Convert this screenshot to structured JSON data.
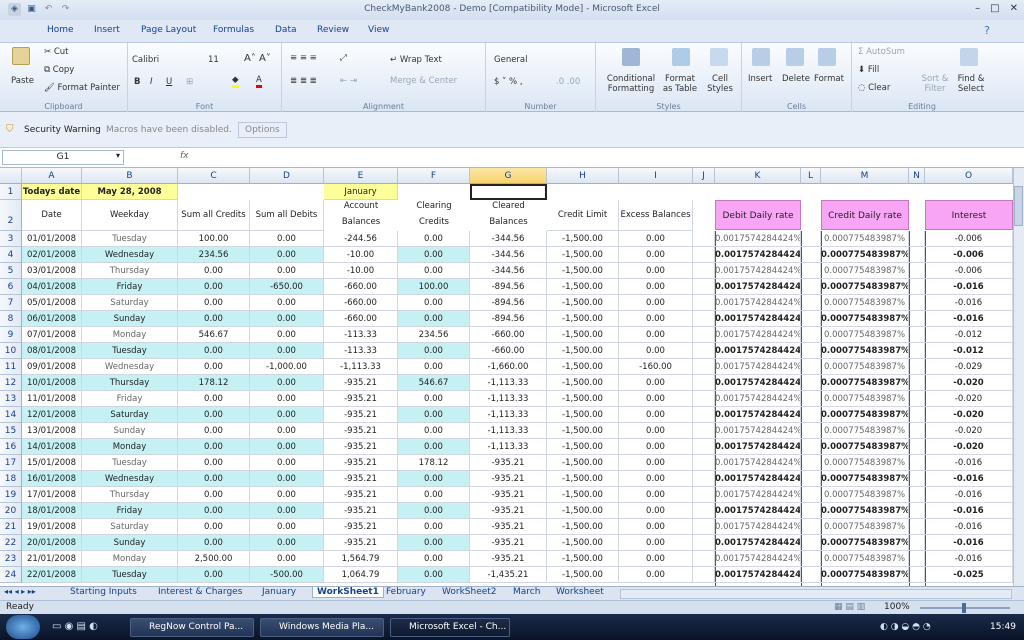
{
  "title": "CheckMyBank2008 - Demo  [Compatibility Mode] - Microsoft Excel",
  "ribbon_tabs": [
    "Home",
    "Insert",
    "Page Layout",
    "Formulas",
    "Data",
    "Review",
    "View"
  ],
  "clipboard": {
    "paste": "Paste",
    "cut": "Cut",
    "copy": "Copy",
    "format_painter": "Format Painter",
    "label": "Clipboard"
  },
  "font": {
    "name": "Calibri",
    "size": "11",
    "label": "Font"
  },
  "alignment": {
    "wrap": "Wrap Text",
    "merge": "Merge & Center",
    "label": "Alignment"
  },
  "number": {
    "format": "General",
    "label": "Number"
  },
  "styles": {
    "conditional": "Conditional Formatting",
    "format_table": "Format as Table",
    "cell_styles": "Cell Styles",
    "label": "Styles"
  },
  "cells": {
    "insert": "Insert",
    "delete": "Delete",
    "format": "Format",
    "label": "Cells"
  },
  "editing": {
    "autosum": "AutoSum",
    "fill": "Fill",
    "clear": "Clear",
    "sort": "Sort & Filter",
    "find": "Find & Select",
    "label": "Editing"
  },
  "warning": {
    "title": "Security Warning",
    "msg": "Macros have been disabled.",
    "options": "Options"
  },
  "formula_bar": {
    "name_box": "G1",
    "fx": "fx",
    "content": ""
  },
  "columns": [
    "A",
    "B",
    "C",
    "D",
    "E",
    "F",
    "G",
    "H",
    "I",
    "J",
    "K",
    "L",
    "M",
    "N",
    "O"
  ],
  "row1": {
    "a": "Todays date",
    "b": "May 28, 2008",
    "e": "January"
  },
  "headers": {
    "date": "Date",
    "weekday": "Weekday",
    "credits": "Sum all Credits",
    "debits": "Sum all Debits",
    "account1": "Account",
    "account2": "Balances",
    "clearing1": "Clearing",
    "clearing2": "Credits",
    "cleared1": "Cleared",
    "cleared2": "Balances",
    "limit": "Credit Limit",
    "excess": "Excess Balances",
    "debit_rate": "Debit Daily rate",
    "credit_rate": "Credit Daily rate",
    "interest": "Interest"
  },
  "rows": [
    {
      "n": "3",
      "date": "01/01/2008",
      "day": "Tuesday",
      "c": "100.00",
      "d": "0.00",
      "e": "-244.56",
      "f": "0.00",
      "g": "-344.56",
      "h": "-1,500.00",
      "i": "0.00",
      "k": "0.0017574284424%",
      "m": "0.000775483987%",
      "o": "-0.006",
      "hl": false
    },
    {
      "n": "4",
      "date": "02/01/2008",
      "day": "Wednesday",
      "c": "234.56",
      "d": "0.00",
      "e": "-10.00",
      "f": "0.00",
      "g": "-344.56",
      "h": "-1,500.00",
      "i": "0.00",
      "k": "0.0017574284424%",
      "m": "0.000775483987%",
      "o": "-0.006",
      "hl": true
    },
    {
      "n": "5",
      "date": "03/01/2008",
      "day": "Thursday",
      "c": "0.00",
      "d": "0.00",
      "e": "-10.00",
      "f": "0.00",
      "g": "-344.56",
      "h": "-1,500.00",
      "i": "0.00",
      "k": "0.0017574284424%",
      "m": "0.000775483987%",
      "o": "-0.006",
      "hl": false
    },
    {
      "n": "6",
      "date": "04/01/2008",
      "day": "Friday",
      "c": "0.00",
      "d": "-650.00",
      "e": "-660.00",
      "f": "100.00",
      "g": "-894.56",
      "h": "-1,500.00",
      "i": "0.00",
      "k": "0.0017574284424%",
      "m": "0.000775483987%",
      "o": "-0.016",
      "hl": true
    },
    {
      "n": "7",
      "date": "05/01/2008",
      "day": "Saturday",
      "c": "0.00",
      "d": "0.00",
      "e": "-660.00",
      "f": "0.00",
      "g": "-894.56",
      "h": "-1,500.00",
      "i": "0.00",
      "k": "0.0017574284424%",
      "m": "0.000775483987%",
      "o": "-0.016",
      "hl": false
    },
    {
      "n": "8",
      "date": "06/01/2008",
      "day": "Sunday",
      "c": "0.00",
      "d": "0.00",
      "e": "-660.00",
      "f": "0.00",
      "g": "-894.56",
      "h": "-1,500.00",
      "i": "0.00",
      "k": "0.0017574284424%",
      "m": "0.000775483987%",
      "o": "-0.016",
      "hl": true
    },
    {
      "n": "9",
      "date": "07/01/2008",
      "day": "Monday",
      "c": "546.67",
      "d": "0.00",
      "e": "-113.33",
      "f": "234.56",
      "g": "-660.00",
      "h": "-1,500.00",
      "i": "0.00",
      "k": "0.0017574284424%",
      "m": "0.000775483987%",
      "o": "-0.012",
      "hl": false
    },
    {
      "n": "10",
      "date": "08/01/2008",
      "day": "Tuesday",
      "c": "0.00",
      "d": "0.00",
      "e": "-113.33",
      "f": "0.00",
      "g": "-660.00",
      "h": "-1,500.00",
      "i": "0.00",
      "k": "0.0017574284424%",
      "m": "0.000775483987%",
      "o": "-0.012",
      "hl": true
    },
    {
      "n": "11",
      "date": "09/01/2008",
      "day": "Wednesday",
      "c": "0.00",
      "d": "-1,000.00",
      "e": "-1,113.33",
      "f": "0.00",
      "g": "-1,660.00",
      "h": "-1,500.00",
      "i": "-160.00",
      "k": "0.0017574284424%",
      "m": "0.000775483987%",
      "o": "-0.029",
      "hl": false
    },
    {
      "n": "12",
      "date": "10/01/2008",
      "day": "Thursday",
      "c": "178.12",
      "d": "0.00",
      "e": "-935.21",
      "f": "546.67",
      "g": "-1,113.33",
      "h": "-1,500.00",
      "i": "0.00",
      "k": "0.0017574284424%",
      "m": "0.000775483987%",
      "o": "-0.020",
      "hl": true
    },
    {
      "n": "13",
      "date": "11/01/2008",
      "day": "Friday",
      "c": "0.00",
      "d": "0.00",
      "e": "-935.21",
      "f": "0.00",
      "g": "-1,113.33",
      "h": "-1,500.00",
      "i": "0.00",
      "k": "0.0017574284424%",
      "m": "0.000775483987%",
      "o": "-0.020",
      "hl": false
    },
    {
      "n": "14",
      "date": "12/01/2008",
      "day": "Saturday",
      "c": "0.00",
      "d": "0.00",
      "e": "-935.21",
      "f": "0.00",
      "g": "-1,113.33",
      "h": "-1,500.00",
      "i": "0.00",
      "k": "0.0017574284424%",
      "m": "0.000775483987%",
      "o": "-0.020",
      "hl": true
    },
    {
      "n": "15",
      "date": "13/01/2008",
      "day": "Sunday",
      "c": "0.00",
      "d": "0.00",
      "e": "-935.21",
      "f": "0.00",
      "g": "-1,113.33",
      "h": "-1,500.00",
      "i": "0.00",
      "k": "0.0017574284424%",
      "m": "0.000775483987%",
      "o": "-0.020",
      "hl": false
    },
    {
      "n": "16",
      "date": "14/01/2008",
      "day": "Monday",
      "c": "0.00",
      "d": "0.00",
      "e": "-935.21",
      "f": "0.00",
      "g": "-1,113.33",
      "h": "-1,500.00",
      "i": "0.00",
      "k": "0.0017574284424%",
      "m": "0.000775483987%",
      "o": "-0.020",
      "hl": true
    },
    {
      "n": "17",
      "date": "15/01/2008",
      "day": "Tuesday",
      "c": "0.00",
      "d": "0.00",
      "e": "-935.21",
      "f": "178.12",
      "g": "-935.21",
      "h": "-1,500.00",
      "i": "0.00",
      "k": "0.0017574284424%",
      "m": "0.000775483987%",
      "o": "-0.016",
      "hl": false
    },
    {
      "n": "18",
      "date": "16/01/2008",
      "day": "Wednesday",
      "c": "0.00",
      "d": "0.00",
      "e": "-935.21",
      "f": "0.00",
      "g": "-935.21",
      "h": "-1,500.00",
      "i": "0.00",
      "k": "0.0017574284424%",
      "m": "0.000775483987%",
      "o": "-0.016",
      "hl": true
    },
    {
      "n": "19",
      "date": "17/01/2008",
      "day": "Thursday",
      "c": "0.00",
      "d": "0.00",
      "e": "-935.21",
      "f": "0.00",
      "g": "-935.21",
      "h": "-1,500.00",
      "i": "0.00",
      "k": "0.0017574284424%",
      "m": "0.000775483987%",
      "o": "-0.016",
      "hl": false
    },
    {
      "n": "20",
      "date": "18/01/2008",
      "day": "Friday",
      "c": "0.00",
      "d": "0.00",
      "e": "-935.21",
      "f": "0.00",
      "g": "-935.21",
      "h": "-1,500.00",
      "i": "0.00",
      "k": "0.0017574284424%",
      "m": "0.000775483987%",
      "o": "-0.016",
      "hl": true
    },
    {
      "n": "21",
      "date": "19/01/2008",
      "day": "Saturday",
      "c": "0.00",
      "d": "0.00",
      "e": "-935.21",
      "f": "0.00",
      "g": "-935.21",
      "h": "-1,500.00",
      "i": "0.00",
      "k": "0.0017574284424%",
      "m": "0.000775483987%",
      "o": "-0.016",
      "hl": false
    },
    {
      "n": "22",
      "date": "20/01/2008",
      "day": "Sunday",
      "c": "0.00",
      "d": "0.00",
      "e": "-935.21",
      "f": "0.00",
      "g": "-935.21",
      "h": "-1,500.00",
      "i": "0.00",
      "k": "0.0017574284424%",
      "m": "0.000775483987%",
      "o": "-0.016",
      "hl": true
    },
    {
      "n": "23",
      "date": "21/01/2008",
      "day": "Monday",
      "c": "2,500.00",
      "d": "0.00",
      "e": "1,564.79",
      "f": "0.00",
      "g": "-935.21",
      "h": "-1,500.00",
      "i": "0.00",
      "k": "0.0017574284424%",
      "m": "0.000775483987%",
      "o": "-0.016",
      "hl": false
    },
    {
      "n": "24",
      "date": "22/01/2008",
      "day": "Tuesday",
      "c": "0.00",
      "d": "-500.00",
      "e": "1,064.79",
      "f": "0.00",
      "g": "-1,435.21",
      "h": "-1,500.00",
      "i": "0.00",
      "k": "0.0017574284424%",
      "m": "0.000775483987%",
      "o": "-0.025",
      "hl": true
    }
  ],
  "sheets": [
    "Starting Inputs",
    "Interest & Charges",
    "January",
    "WorkSheet1",
    "February",
    "WorkSheet2",
    "March",
    "Worksheet"
  ],
  "active_sheet": "WorkSheet1",
  "status": {
    "ready": "Ready",
    "zoom": "100%"
  },
  "taskbar": {
    "items": [
      "RegNow Control Pa...",
      "Windows Media Pla...",
      "Microsoft Excel - Ch..."
    ],
    "clock": "15:49"
  },
  "colors": {
    "highlight": "#c6f1f4",
    "yellow": "#ffff99",
    "pink": "#f9a5f5"
  }
}
